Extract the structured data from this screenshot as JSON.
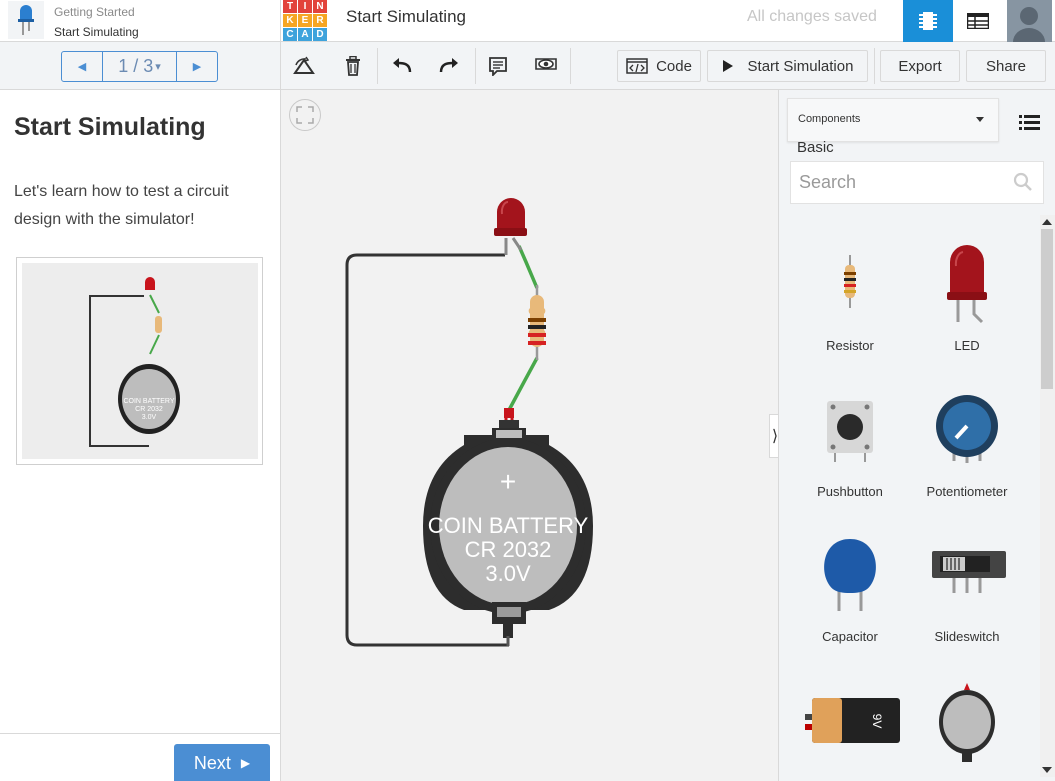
{
  "lesson": {
    "category": "Getting Started",
    "title_small": "Start Simulating",
    "pager": {
      "counter": "1 / 3",
      "dropdown": "▾"
    },
    "heading": "Start Simulating",
    "body": "Let's learn how to test a circuit design with the simulator!",
    "next_label": "Next"
  },
  "header": {
    "logo_letters": [
      "T",
      "I",
      "N",
      "K",
      "E",
      "R",
      "C",
      "A",
      "D"
    ],
    "logo_colors": [
      "#e2433b",
      "#e2433b",
      "#e2433b",
      "#f6a623",
      "#f6a623",
      "#f6a623",
      "#3ea3dc",
      "#3ea3dc",
      "#3ea3dc"
    ],
    "doc_title": "Start Simulating",
    "save_status": "All changes saved"
  },
  "toolbar": {
    "code_label": "Code",
    "start_sim_label": "Start Simulation",
    "export_label": "Export",
    "share_label": "Share"
  },
  "battery": {
    "line1": "COIN BATTERY",
    "line2": "CR 2032",
    "line3": "3.0V",
    "plus": "+"
  },
  "panel": {
    "dropdown_label": "Components",
    "dropdown_value": "Basic",
    "search_placeholder": "Search",
    "components": [
      {
        "label": "Resistor"
      },
      {
        "label": "LED"
      },
      {
        "label": "Pushbutton"
      },
      {
        "label": "Potentiometer"
      },
      {
        "label": "Capacitor"
      },
      {
        "label": "Slideswitch"
      }
    ],
    "nine_volt_label": "9V"
  },
  "colors": {
    "accent": "#4b8ed3",
    "active_view": "#1a8fd8",
    "led_red": "#a3141c",
    "wire_green": "#48a84a",
    "wire_dark": "#333333"
  }
}
